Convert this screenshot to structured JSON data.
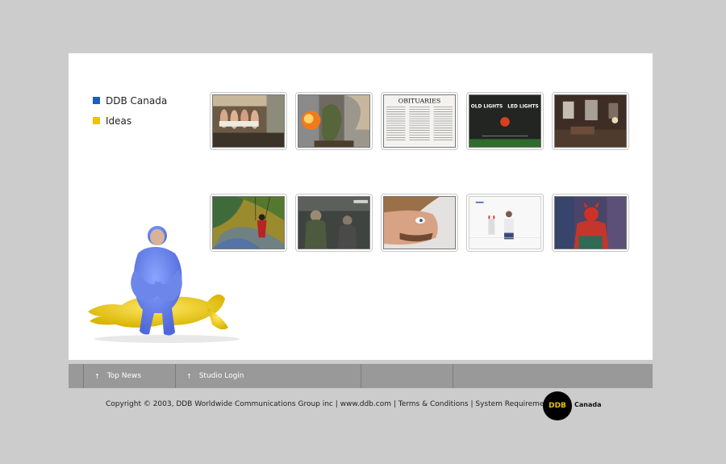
{
  "nav": {
    "items": [
      {
        "label": "DDB Canada",
        "color": "#1a5fc0"
      },
      {
        "label": "Ideas",
        "color": "#f2c200"
      }
    ]
  },
  "thumbnails": {
    "row1": [
      {
        "name": "men-in-towels-thumb"
      },
      {
        "name": "fire-creature-thumb"
      },
      {
        "name": "obituaries-thumb",
        "headline": "OBITUARIES"
      },
      {
        "name": "old-led-lights-thumb",
        "text_left": "OLD LIGHTS",
        "text_right": "LED LIGHTS"
      },
      {
        "name": "dark-room-thumb"
      }
    ],
    "row2": [
      {
        "name": "swing-painting-thumb"
      },
      {
        "name": "soldiers-thumb"
      },
      {
        "name": "face-closeup-thumb"
      },
      {
        "name": "white-room-thumb"
      },
      {
        "name": "red-devil-thumb"
      }
    ]
  },
  "footer": {
    "links": [
      {
        "label": "Top News",
        "arrow": "↑"
      },
      {
        "label": "Studio Login",
        "arrow": "↑"
      }
    ],
    "copyright": "Copyright © 2003, DDB Worldwide Communications Group inc | www.ddb.com | Terms & Conditions | System Requirements |",
    "logo_text": "DDB",
    "logo_region": "Canada"
  },
  "colors": {
    "background": "#cccccc",
    "panel": "#ffffff",
    "footer_bar": "#999999"
  }
}
